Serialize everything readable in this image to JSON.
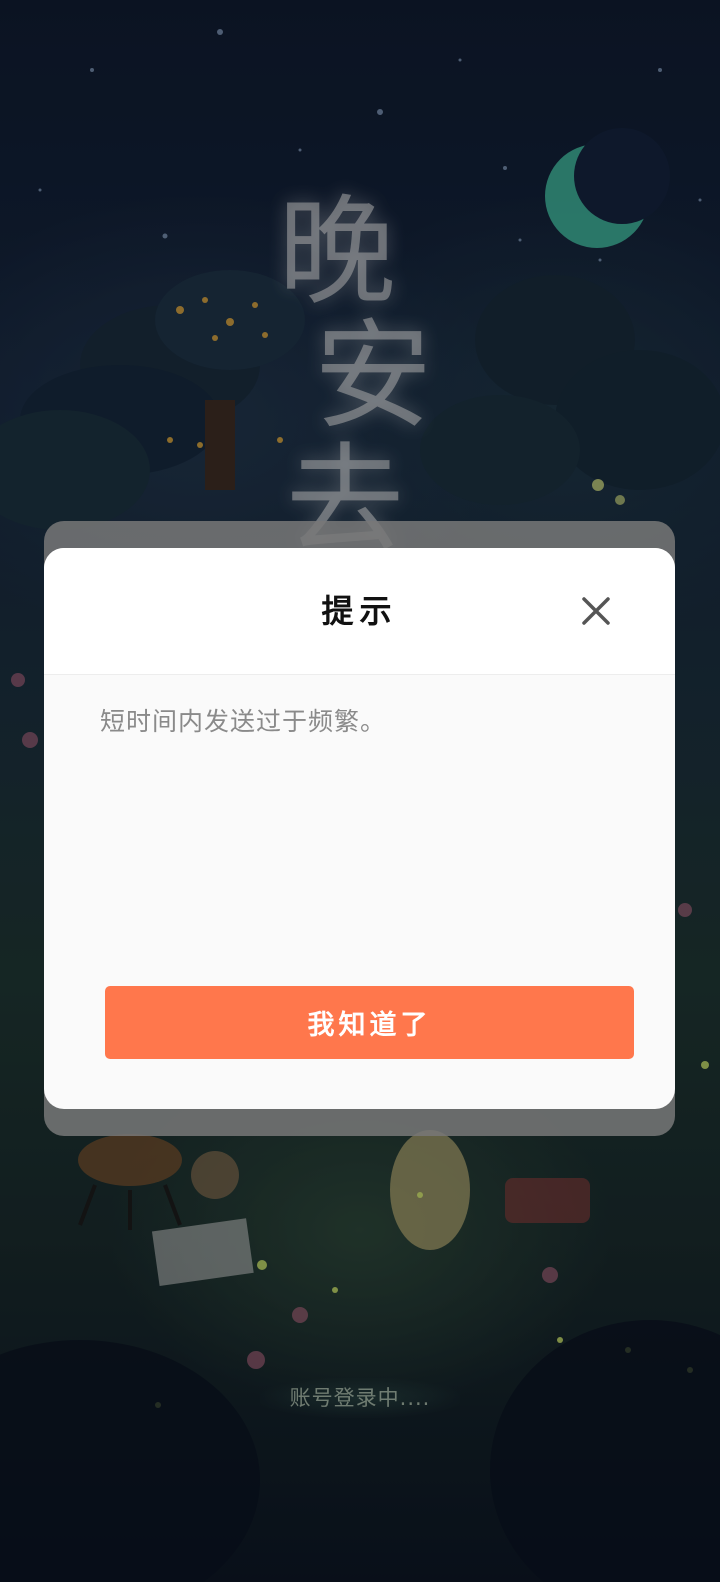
{
  "game": {
    "title_art_chars": [
      "晚",
      "安",
      "去"
    ],
    "loading_text": "账号登录中...."
  },
  "dialog": {
    "title": "提示",
    "message": "短时间内发送过于频繁。",
    "confirm_label": "我知道了",
    "close_icon": "close-icon"
  },
  "colors": {
    "accent": "#ff774c",
    "moon": "#3fb59a",
    "overlay": "#7a7a7a"
  }
}
